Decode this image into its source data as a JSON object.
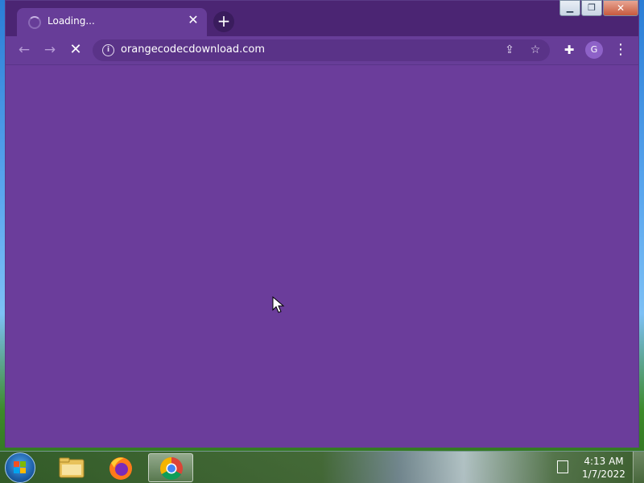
{
  "browser": {
    "tab": {
      "title": "Loading..."
    },
    "url": "orangecodecdownload.com",
    "avatar_letter": "G"
  },
  "colors": {
    "frame": "#4b2573",
    "toolbar": "#673d98",
    "content": "#6b3d9b"
  },
  "icons": {
    "tab_close": "close-icon",
    "new_tab": "plus-icon",
    "back": "back-arrow-icon",
    "forward": "forward-arrow-icon",
    "stop": "stop-icon",
    "site_info": "info-icon",
    "share": "share-icon",
    "bookmark": "star-icon",
    "extensions": "puzzle-icon",
    "menu": "kebab-menu-icon"
  },
  "taskbar": {
    "apps": [
      "File Explorer",
      "Firefox",
      "Chrome"
    ],
    "clock": {
      "time": "4:13 AM",
      "date": "1/7/2022"
    }
  }
}
